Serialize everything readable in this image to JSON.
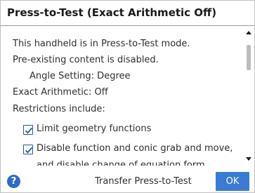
{
  "dialog": {
    "title": "Press-to-Test (Exact Arithmetic Off)"
  },
  "content": {
    "line1": "This handheld is in Press-to-Test mode.",
    "line2": "Pre-existing content is disabled.",
    "angle_setting": "Angle Setting: Degree",
    "exact_arithmetic": "Exact Arithmetic: Off",
    "restrictions_heading": "Restrictions include:",
    "restrictions": [
      {
        "label": "Limit geometry functions",
        "checked": true
      },
      {
        "label": "Disable function and conic grab and move,",
        "checked": true
      },
      {
        "label": "and disable change of equation form",
        "checked": true
      }
    ]
  },
  "footer": {
    "help_icon": "question-mark-icon",
    "help_glyph": "?",
    "transfer_label": "Transfer Press-to-Test",
    "ok_label": "OK"
  },
  "colors": {
    "accent": "#3a7bd5",
    "checkbox_border": "#1e56a0"
  }
}
